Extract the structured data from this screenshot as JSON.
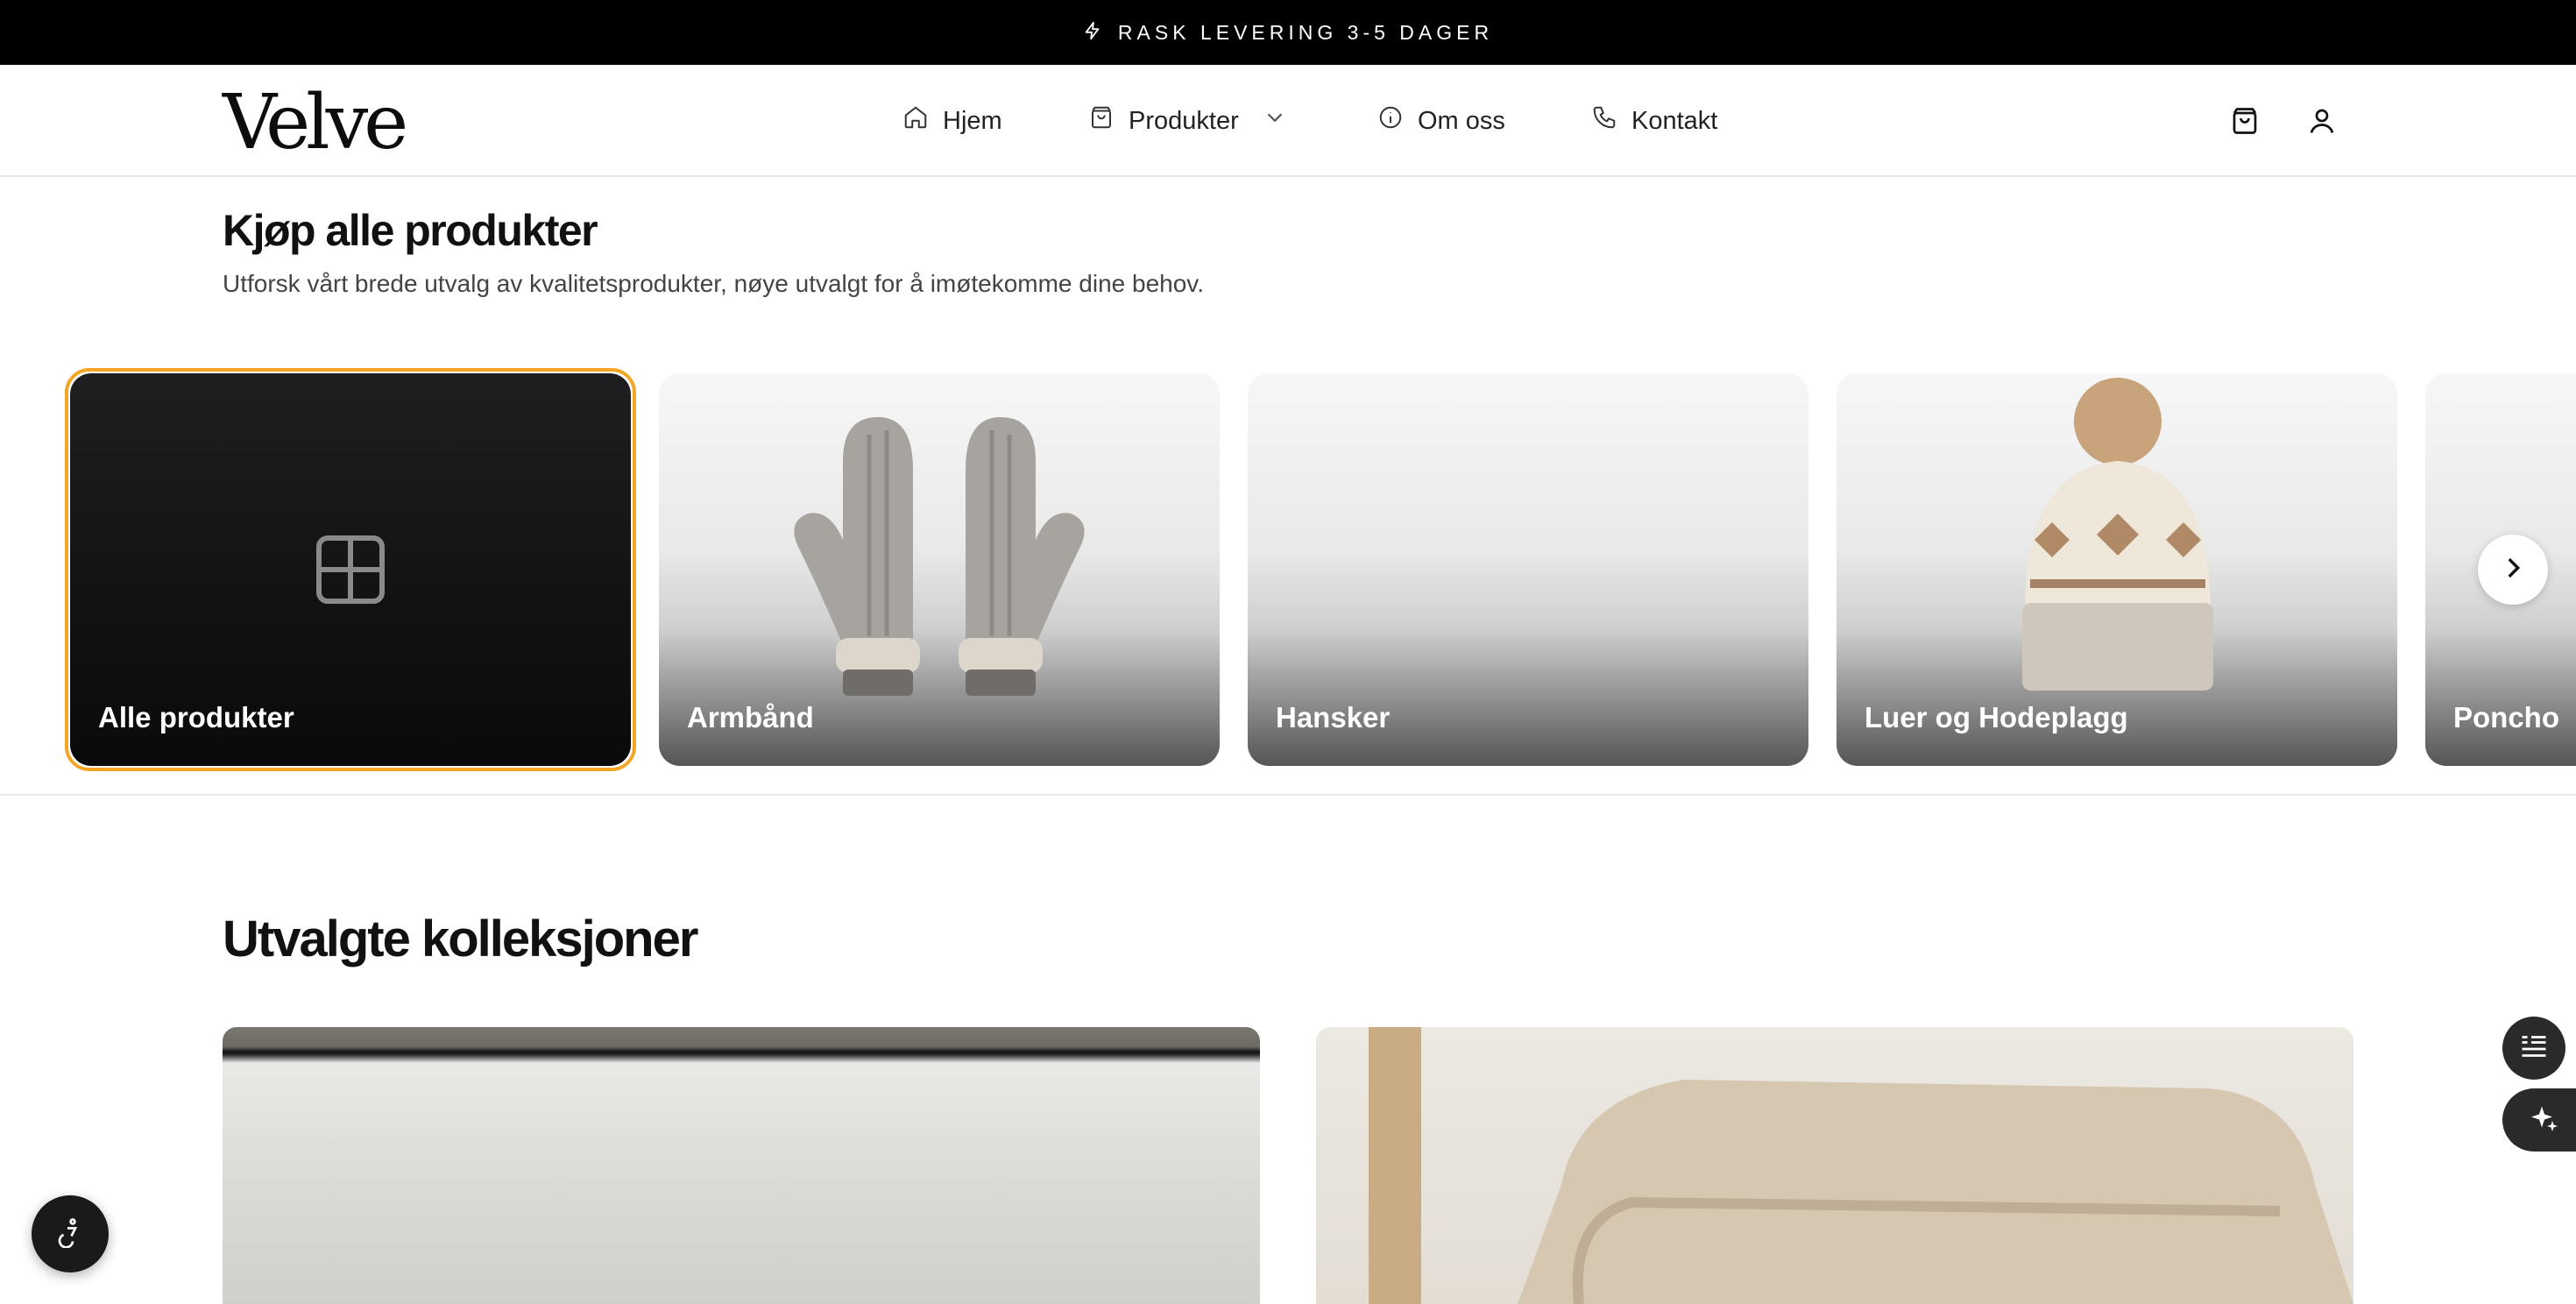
{
  "announcement": {
    "text": "RASK LEVERING 3-5 DAGER",
    "icon": "bolt-icon"
  },
  "header": {
    "logo": "Velve",
    "nav": [
      {
        "label": "Hjem",
        "icon": "home-icon"
      },
      {
        "label": "Produkter",
        "icon": "shopping-bag-icon",
        "dropdown": true
      },
      {
        "label": "Om oss",
        "icon": "info-icon"
      },
      {
        "label": "Kontakt",
        "icon": "phone-icon"
      }
    ],
    "actions": [
      "cart-icon",
      "user-icon"
    ]
  },
  "shop": {
    "title": "Kjøp alle produkter",
    "subtitle": "Utforsk vårt brede utvalg av kvalitetsprodukter, nøye utvalgt for å imøtekomme dine behov.",
    "categories": [
      {
        "label": "Alle produkter",
        "selected": true
      },
      {
        "label": "Armbånd"
      },
      {
        "label": "Hansker"
      },
      {
        "label": "Luer og Hodeplagg"
      },
      {
        "label": "Poncho"
      }
    ]
  },
  "collections": {
    "title": "Utvalgte kolleksjoner"
  },
  "colors": {
    "accent": "#f5a524",
    "topbar": "#000000",
    "text": "#111111"
  }
}
